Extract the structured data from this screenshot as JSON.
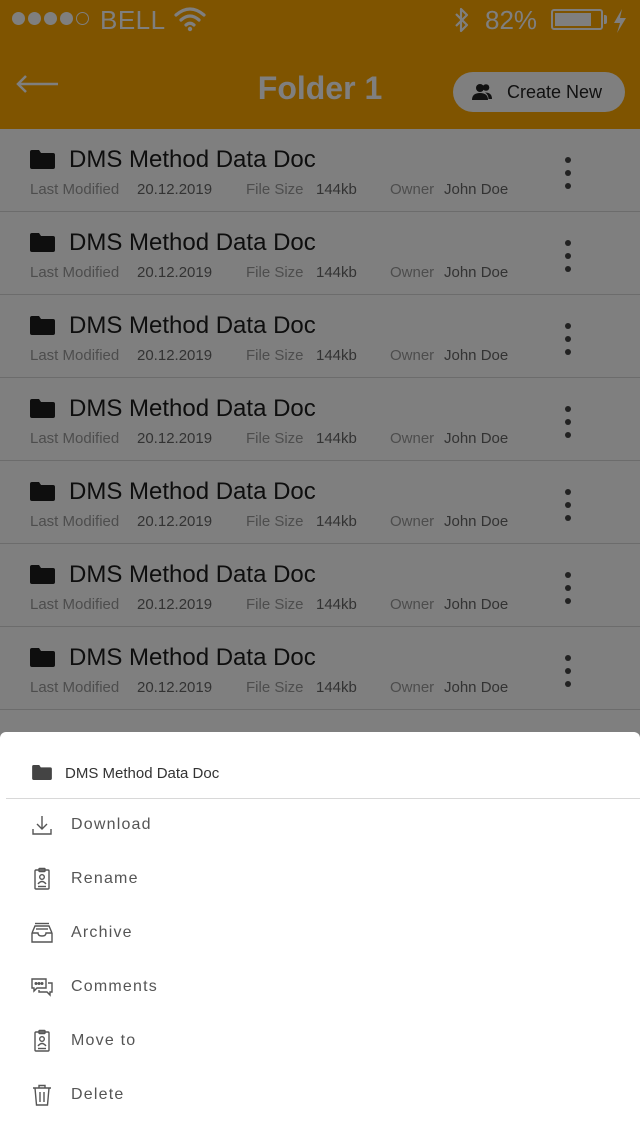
{
  "status_bar": {
    "carrier": "BELL",
    "battery_percent": "82%",
    "battery_level": 0.82
  },
  "header": {
    "title": "Folder 1",
    "create_label": "Create New"
  },
  "files": [
    {
      "name": "DMS Method Data Doc",
      "modified_label": "Last Modified",
      "modified": "20.12.2019",
      "size_label": "File Size",
      "size": "144kb",
      "owner_label": "Owner",
      "owner": "John Doe"
    },
    {
      "name": "DMS Method Data Doc",
      "modified_label": "Last Modified",
      "modified": "20.12.2019",
      "size_label": "File Size",
      "size": "144kb",
      "owner_label": "Owner",
      "owner": "John Doe"
    },
    {
      "name": "DMS Method Data Doc",
      "modified_label": "Last Modified",
      "modified": "20.12.2019",
      "size_label": "File Size",
      "size": "144kb",
      "owner_label": "Owner",
      "owner": "John Doe"
    },
    {
      "name": "DMS Method Data Doc",
      "modified_label": "Last Modified",
      "modified": "20.12.2019",
      "size_label": "File Size",
      "size": "144kb",
      "owner_label": "Owner",
      "owner": "John Doe"
    },
    {
      "name": "DMS Method Data Doc",
      "modified_label": "Last Modified",
      "modified": "20.12.2019",
      "size_label": "File Size",
      "size": "144kb",
      "owner_label": "Owner",
      "owner": "John Doe"
    },
    {
      "name": "DMS Method Data Doc",
      "modified_label": "Last Modified",
      "modified": "20.12.2019",
      "size_label": "File Size",
      "size": "144kb",
      "owner_label": "Owner",
      "owner": "John Doe"
    },
    {
      "name": "DMS Method Data Doc",
      "modified_label": "Last Modified",
      "modified": "20.12.2019",
      "size_label": "File Size",
      "size": "144kb",
      "owner_label": "Owner",
      "owner": "John Doe"
    }
  ],
  "sheet": {
    "title": "DMS Method Data Doc",
    "actions": [
      {
        "label": "Download",
        "icon": "download-icon"
      },
      {
        "label": "Rename",
        "icon": "rename-icon"
      },
      {
        "label": "Archive",
        "icon": "archive-icon"
      },
      {
        "label": "Comments",
        "icon": "comments-icon"
      },
      {
        "label": "Move to",
        "icon": "move-icon"
      },
      {
        "label": "Delete",
        "icon": "trash-icon"
      }
    ]
  },
  "colors": {
    "accent": "#ffa800",
    "scrim": "rgba(0,0,0,0.5)",
    "text_dark": "#1c1c1c",
    "text_muted": "#9a9a9a"
  }
}
